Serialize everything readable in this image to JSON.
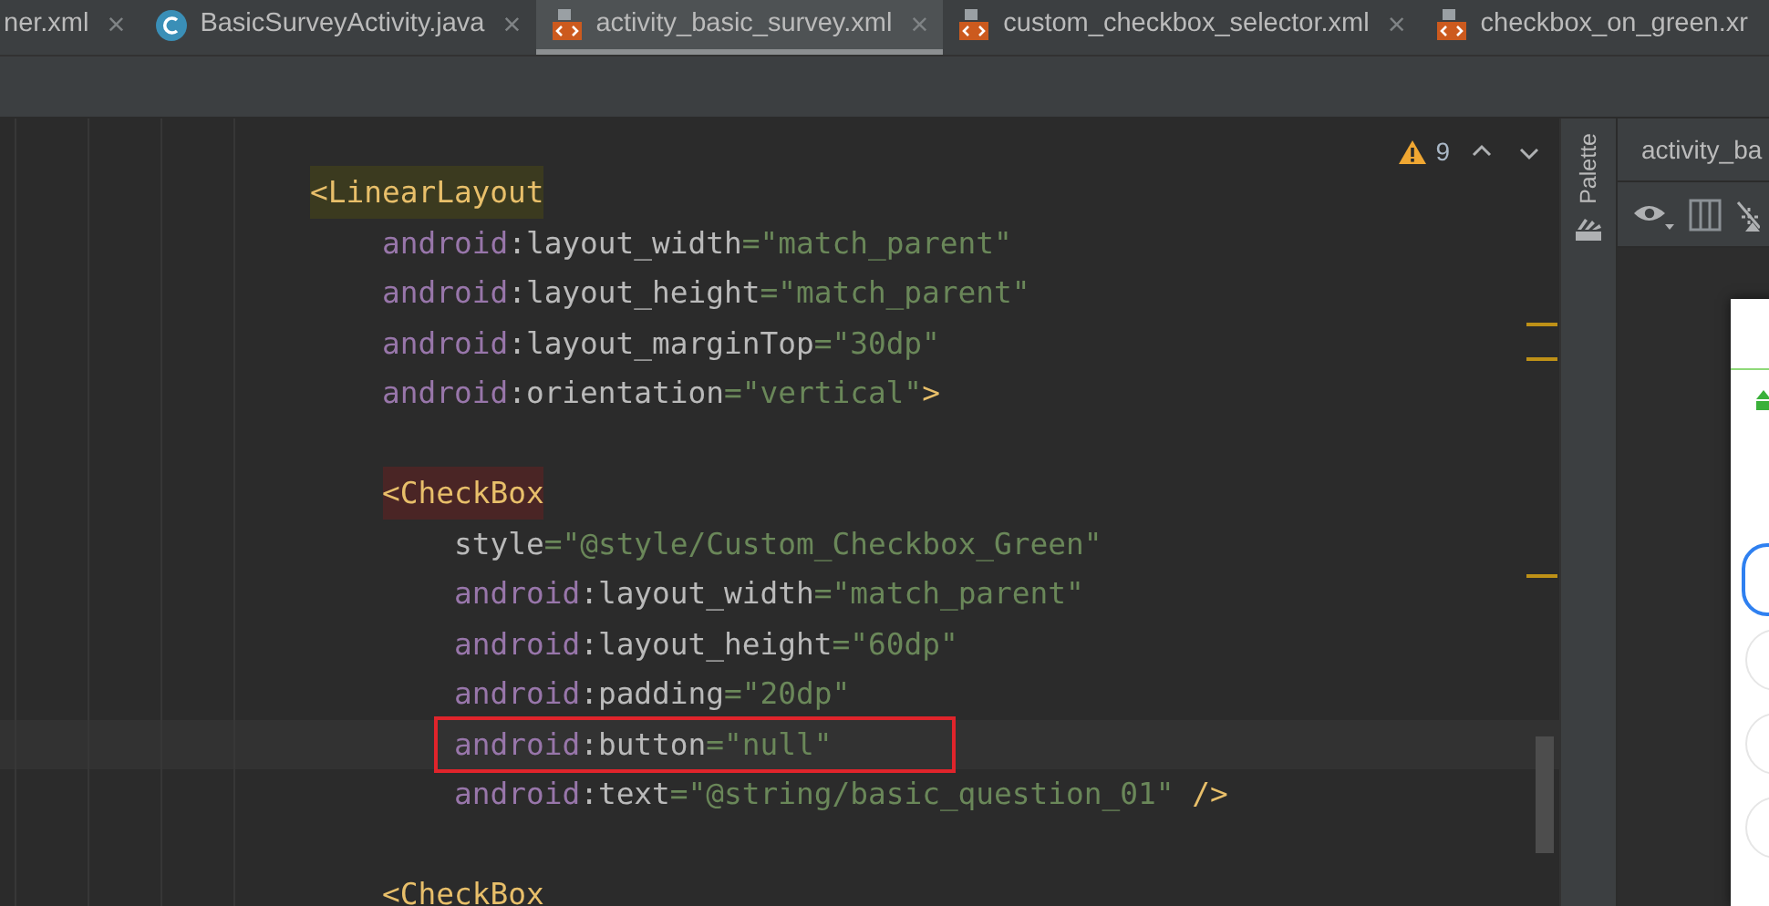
{
  "tabs": [
    {
      "label": "ner.xml",
      "kind": "partial",
      "selected": false,
      "close": "×"
    },
    {
      "label": "BasicSurveyActivity.java",
      "kind": "java",
      "selected": false,
      "close": "×"
    },
    {
      "label": "activity_basic_survey.xml",
      "kind": "xml",
      "selected": true,
      "close": "×"
    },
    {
      "label": "custom_checkbox_selector.xml",
      "kind": "xml",
      "selected": false,
      "close": "×"
    },
    {
      "label": "checkbox_on_green.xr",
      "kind": "xml",
      "selected": false
    }
  ],
  "editor": {
    "warnings": "9",
    "lines": [
      {
        "boxed": false,
        "segments": [
          {
            "kind": "tag",
            "text": "<LinearLayout",
            "color": "#3b3a1f"
          }
        ],
        "children": [
          {
            "boxed": false,
            "segments": [
              {
                "kind": "ns",
                "text": "android"
              },
              {
                "kind": "attr",
                "text": ":layout_width"
              },
              {
                "kind": "value",
                "text": "=\"match_parent\""
              }
            ]
          },
          {
            "boxed": false,
            "segments": [
              {
                "kind": "ns",
                "text": "android"
              },
              {
                "kind": "attr",
                "text": ":layout_height"
              },
              {
                "kind": "value",
                "text": "=\"match_parent\""
              }
            ]
          },
          {
            "boxed": false,
            "segments": [
              {
                "kind": "ns",
                "text": "android"
              },
              {
                "kind": "attr",
                "text": ":layout_marginTop"
              },
              {
                "kind": "value",
                "text": "=\"30dp\""
              }
            ]
          },
          {
            "boxed": false,
            "segments": [
              {
                "kind": "ns",
                "text": "android"
              },
              {
                "kind": "attr",
                "text": ":orientation"
              },
              {
                "kind": "value",
                "text": "=\"vertical\""
              },
              {
                "kind": "tag",
                "text": ">"
              }
            ]
          },
          {
            "boxed": false
          },
          {
            "boxed": false,
            "segments": [
              {
                "kind": "tag",
                "text": "<CheckBox",
                "color": "#4a2525"
              }
            ],
            "children": [
              {
                "boxed": false,
                "segments": [
                  {
                    "kind": "attr",
                    "text": "style"
                  },
                  {
                    "kind": "value",
                    "text": "=\"@style/Custom_Checkbox_Green\""
                  }
                ]
              },
              {
                "boxed": false,
                "segments": [
                  {
                    "kind": "ns",
                    "text": "android"
                  },
                  {
                    "kind": "attr",
                    "text": ":layout_width"
                  },
                  {
                    "kind": "value",
                    "text": "=\"match_parent\""
                  }
                ]
              },
              {
                "boxed": false,
                "segments": [
                  {
                    "kind": "ns",
                    "text": "android"
                  },
                  {
                    "kind": "attr",
                    "text": ":layout_height"
                  },
                  {
                    "kind": "value",
                    "text": "=\"60dp\""
                  }
                ]
              },
              {
                "boxed": false,
                "segments": [
                  {
                    "kind": "ns",
                    "text": "android"
                  },
                  {
                    "kind": "attr",
                    "text": ":padding"
                  },
                  {
                    "kind": "value",
                    "text": "=\"20dp\""
                  }
                ]
              },
              {
                "boxed": true,
                "segments": [
                  {
                    "kind": "ns",
                    "text": "android"
                  },
                  {
                    "kind": "attr",
                    "text": ":button"
                  },
                  {
                    "kind": "value",
                    "text": "=\"null\""
                  }
                ]
              },
              {
                "boxed": false,
                "segments": [
                  {
                    "kind": "ns",
                    "text": "android"
                  },
                  {
                    "kind": "attr",
                    "text": ":text"
                  },
                  {
                    "kind": "value",
                    "text": "=\"@string/basic_question_01\""
                  },
                  {
                    "kind": "tag",
                    "text": " />"
                  }
                ]
              }
            ]
          },
          {
            "boxed": false
          },
          {
            "boxed": false,
            "segments": [
              {
                "kind": "tag",
                "text": "<CheckBox"
              }
            ]
          }
        ]
      }
    ]
  },
  "palette": {
    "label": "Palette"
  },
  "design": {
    "title": "activity_ba"
  }
}
